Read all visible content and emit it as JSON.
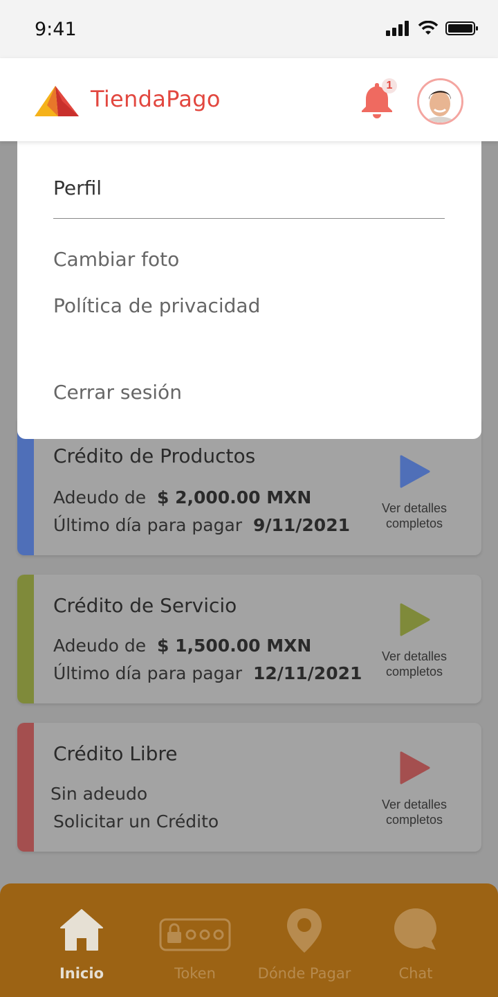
{
  "status_bar": {
    "time": "9:41"
  },
  "header": {
    "brand": "TiendaPago",
    "notification_count": "1",
    "colors": {
      "brand": "#e2473f",
      "bell": "#ef6a60"
    }
  },
  "profile_menu": {
    "title": "Perfil",
    "items": [
      {
        "label": "Cambiar foto"
      },
      {
        "label": "Política de privacidad"
      },
      {
        "label": "Cerrar sesión"
      }
    ]
  },
  "credits": [
    {
      "title": "Crédito de Productos",
      "debt_label": "Adeudo de",
      "debt_value": "$ 2,000.00 MXN",
      "due_label": "Último día para pagar",
      "due_value": "9/11/2021",
      "action_label": "Ver detalles completos",
      "accent": "#4f6fb8"
    },
    {
      "title": "Crédito de Servicio",
      "debt_label": "Adeudo de",
      "debt_value": "$ 1,500.00 MXN",
      "due_label": "Último día para pagar",
      "due_value": "12/11/2021",
      "action_label": "Ver detalles completos",
      "accent": "#7f8a3a"
    },
    {
      "title": "Crédito Libre",
      "line1": "Sin adeudo",
      "line2": "Solicitar un Crédito",
      "action_label": "Ver detalles completos",
      "accent": "#a44f4f"
    }
  ],
  "bottom_nav": {
    "items": [
      {
        "label": "Inicio",
        "icon": "home-icon",
        "active": true
      },
      {
        "label": "Token",
        "icon": "token-icon"
      },
      {
        "label": "Dónde Pagar",
        "icon": "location-icon"
      },
      {
        "label": "Chat",
        "icon": "chat-icon"
      }
    ]
  }
}
